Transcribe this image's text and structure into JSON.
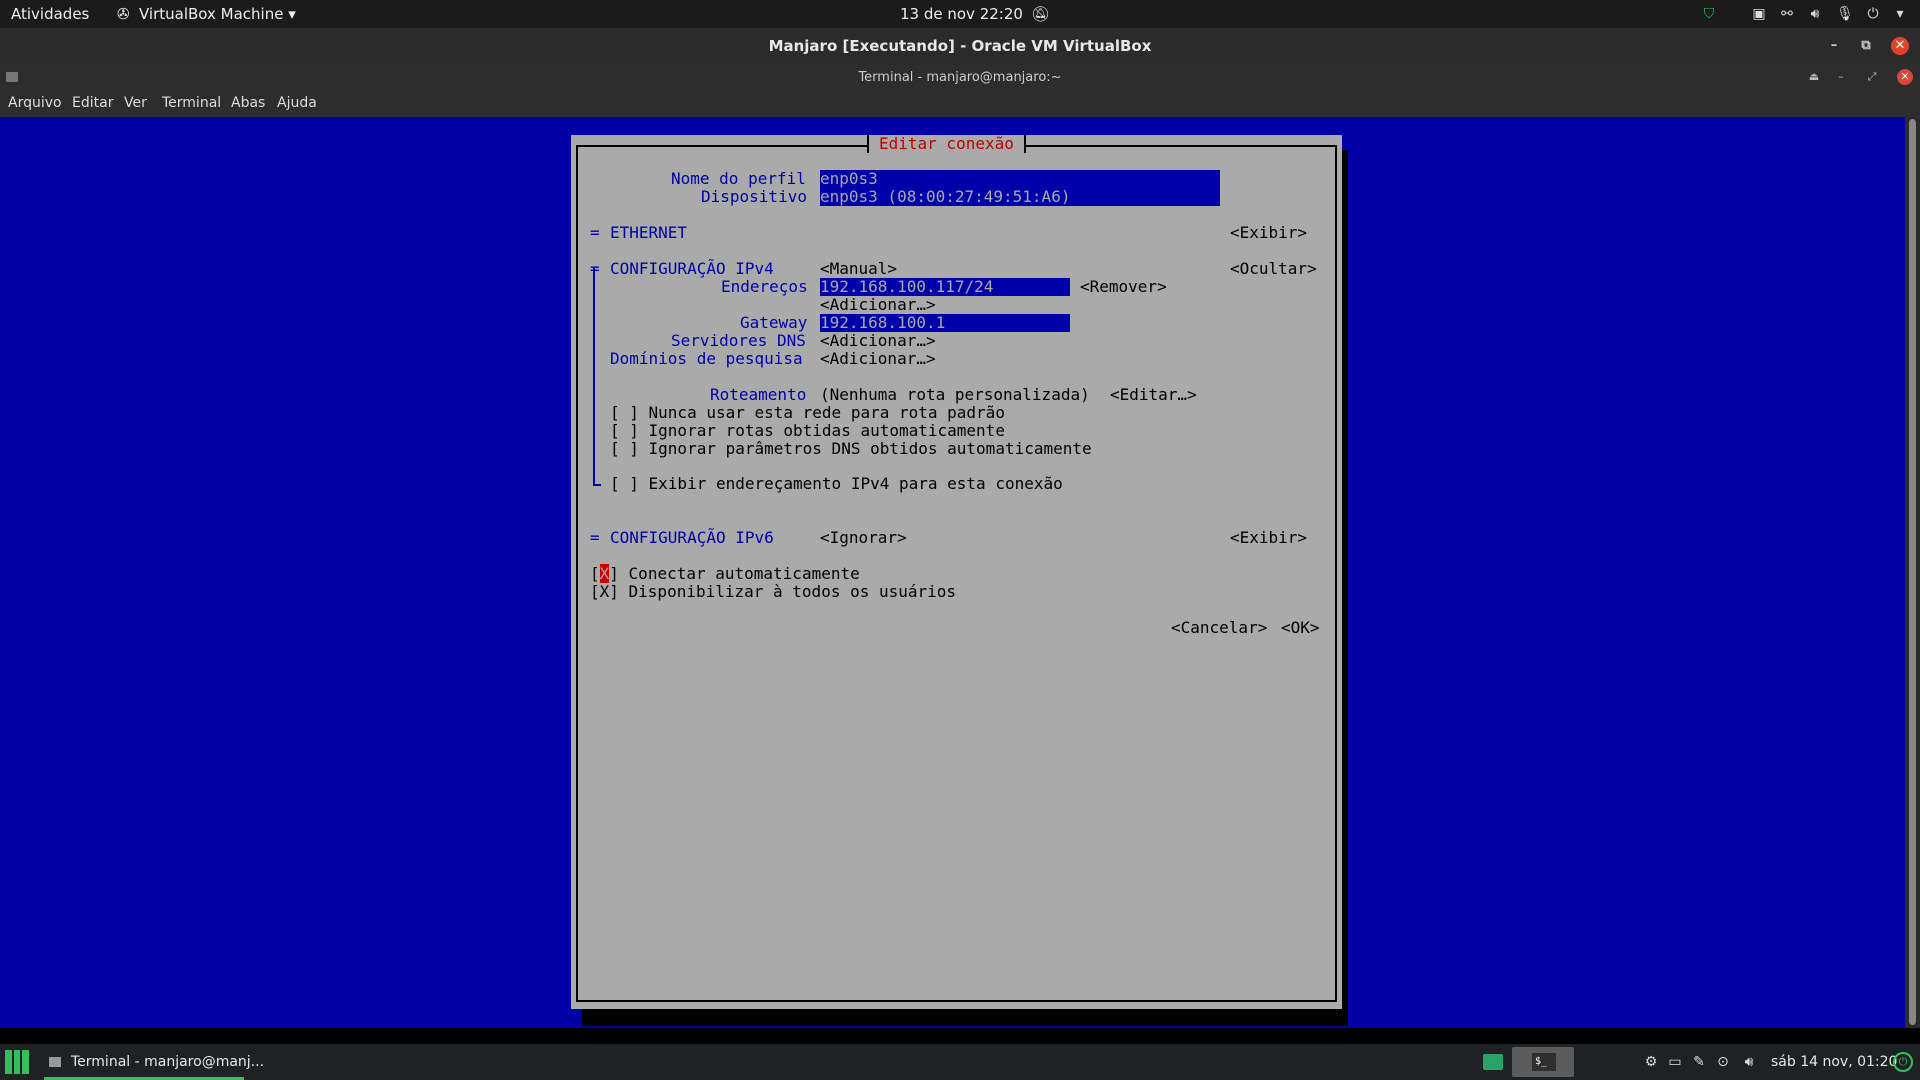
{
  "gnome": {
    "activities": "Atividades",
    "app_menu": "VirtualBox Machine",
    "app_menu_arrow": "▾",
    "clock": "13 de nov  22:20",
    "notif_icon": "bell-off-icon"
  },
  "vbox": {
    "title": "Manjaro [Executando] - Oracle VM VirtualBox"
  },
  "terminal": {
    "title": "Terminal - manjaro@manjaro:~",
    "menu": [
      "Arquivo",
      "Editar",
      "Ver",
      "Terminal",
      "Abas",
      "Ajuda"
    ]
  },
  "dialog": {
    "title": "Editar conexão",
    "profile_label": "Nome do perfil",
    "profile_value": "enp0s3",
    "device_label": "Dispositivo",
    "device_value": "enp0s3 (08:00:27:49:51:A6)",
    "ethernet": {
      "marker": "=",
      "label": "ETHERNET",
      "action": "<Exibir>"
    },
    "ipv4": {
      "marker": "=",
      "label": "CONFIGURAÇÃO IPv4",
      "mode": "<Manual>",
      "action": "<Ocultar>",
      "addresses_label": "Endereços",
      "address_value": "192.168.100.117/24",
      "remove": "<Remover>",
      "add_address": "<Adicionar…>",
      "gateway_label": "Gateway",
      "gateway_value": "192.168.100.1",
      "dns_label": "Servidores DNS",
      "dns_add": "<Adicionar…>",
      "search_label": "Domínios de pesquisa",
      "search_add": "<Adicionar…>",
      "routing_label": "Roteamento",
      "routing_value": "(Nenhuma rota personalizada)",
      "routing_edit": "<Editar…>",
      "never_default": "[ ] Nunca usar esta rede para rota padrão",
      "ignore_routes": "[ ] Ignorar rotas obtidas automaticamente",
      "ignore_dns": "[ ] Ignorar parâmetros DNS obtidos automaticamente",
      "require_ipv4": "[ ] Exibir endereçamento IPv4 para esta conexão"
    },
    "ipv6": {
      "marker": "=",
      "label": "CONFIGURAÇÃO IPv6",
      "mode": "<Ignorar>",
      "action": "<Exibir>"
    },
    "auto_connect_open": "[",
    "auto_connect_mark": "X",
    "auto_connect_rest": "] Conectar automaticamente",
    "all_users": "[X] Disponibilizar à todos os usuários",
    "cancel": "<Cancelar>",
    "ok": "<OK>"
  },
  "panel": {
    "task_label": "Terminal - manjaro@manj...",
    "clock": "sáb 14 nov, 01:20"
  },
  "colors": {
    "terminal_bg": "#0000a6",
    "dialog_bg": "#aaaaaa",
    "label": "#0000aa",
    "title_red": "#c00000",
    "manjaro_green": "#35bf5c"
  }
}
